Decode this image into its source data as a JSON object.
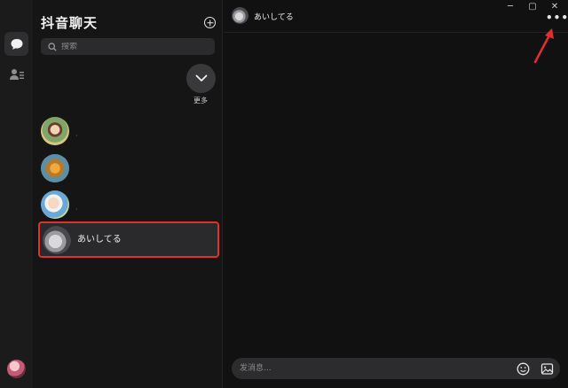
{
  "app": {
    "title": "抖音聊天"
  },
  "rail": {
    "items": [
      {
        "icon": "chat-bubble-icon",
        "active": true
      },
      {
        "icon": "contacts-icon",
        "active": false
      }
    ],
    "user_avatar": "user-avatar"
  },
  "search": {
    "placeholder": "搜索"
  },
  "more": {
    "label": "更多"
  },
  "contacts": [
    {
      "name": "",
      "dot": "·",
      "avatar": "girl-photo"
    },
    {
      "name": "",
      "dot": "",
      "avatar": "autumn-tree-photo"
    },
    {
      "name": "",
      "dot": "·",
      "avatar": "baby-photo"
    },
    {
      "name": "あいしてる",
      "dot": "",
      "avatar": "gray-figure-photo",
      "selected": true
    }
  ],
  "chat": {
    "name": "あいしてる",
    "window_controls": {
      "minimize": "─",
      "maximize": "▢",
      "close": "✕"
    },
    "menu_dots": "•••",
    "composer_placeholder": "发消息..."
  },
  "colors": {
    "background": "#111112",
    "panel": "#151516",
    "selection_border": "#e0302d",
    "annotation_arrow": "#e0302d"
  }
}
